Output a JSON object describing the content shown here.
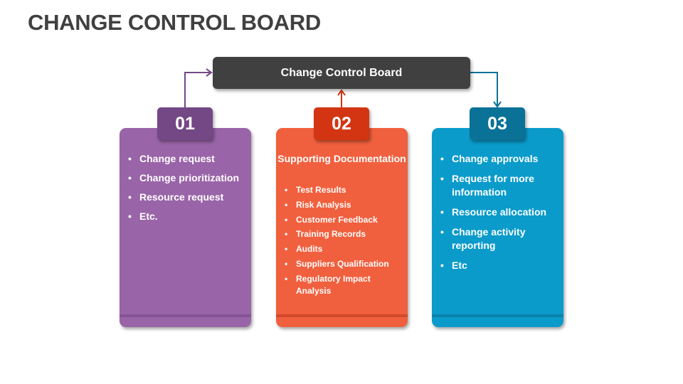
{
  "title": "CHANGE CONTROL BOARD",
  "board": {
    "label": "Change Control Board",
    "color": "#404040"
  },
  "cards": [
    {
      "number": "01",
      "color": "#9a64a8",
      "badge_color": "#744785",
      "band_color": "#845295",
      "arrow_color": "#744785",
      "items": [
        "Change request",
        "Change prioritization",
        "Resource request",
        "Etc."
      ]
    },
    {
      "number": "02",
      "color": "#f1603e",
      "badge_color": "#d33513",
      "band_color": "#d24a2c",
      "arrow_color": "#d33513",
      "subtitle": "Supporting Documentation",
      "items": [
        "Test Results",
        "Risk Analysis",
        "Customer Feedback",
        "Training Records",
        "Audits",
        "Suppliers Qualification",
        "Regulatory Impact Analysis"
      ]
    },
    {
      "number": "03",
      "color": "#0a9bcb",
      "badge_color": "#0b7297",
      "band_color": "#0883ac",
      "arrow_color": "#0b7297",
      "items": [
        "Change approvals",
        "Request for more information",
        "Resource allocation",
        "Change activity reporting",
        "Etc"
      ]
    }
  ]
}
